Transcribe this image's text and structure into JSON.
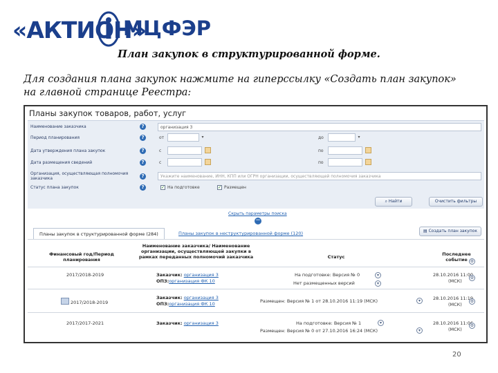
{
  "branding": {
    "aktion": "«АКТИОН»",
    "mcfer": "МЦФЭР",
    "seal_letter": "i"
  },
  "slide": {
    "title": "План закупок в структурированной форме.",
    "text": "Для создания плана закупок нажмите на гиперссылку «Создать план закупок» на главной странице Реестра:",
    "page_number": "20"
  },
  "panel": {
    "title": "Планы закупок товаров, работ, услуг",
    "filters": {
      "customer_label": "Наименование заказчика",
      "customer_value": "организация 3",
      "period_label": "Период планирования",
      "from": "от",
      "to": "до",
      "approval_label": "Дата утверждения плана закупок",
      "placement_label": "Дата размещения сведений",
      "c": "с",
      "po": "по",
      "org_label": "Организация, осуществляющая полномочия заказчика",
      "org_placeholder": "Укажите наименование, ИНН, КПП или ОГРН организации, осуществляющей полномочия заказчика",
      "status_label": "Статус плана закупок",
      "status_opt1": "На подготовке",
      "status_opt2": "Размещен",
      "find_button": "Найти",
      "clear_button": "Очистить фильтры",
      "collapse_link": "Скрыть параметры поиска"
    },
    "tabs": {
      "tab1": "Планы закупок в структурированной форме (284)",
      "tab2": "Планы закупок в неструктурированной форме (120)",
      "create_button": "Создать план закупок"
    },
    "table": {
      "headers": {
        "period": "Финансовый год/Период планирования",
        "customer": "Наименование заказчика/ Наименование организации, осуществляющей закупки в рамках переданных полномочий заказчика",
        "status": "Статус",
        "last_event": "Последнее событие"
      },
      "rows": [
        {
          "period": "2017/2018-2019",
          "customer_label": "Заказчик:",
          "customer_value": "организация 3",
          "ops_label": "ОПЗ:",
          "ops_value": "организация ФК 10",
          "status1": "На подготовке: Версия № 0",
          "status2": "Нет размещенных версий",
          "date": "28.10.2016 11:00",
          "tz": "(МСК)"
        },
        {
          "period": "2017/2018-2019",
          "customer_label": "Заказчик:",
          "customer_value": "организация 3",
          "ops_label": "ОПЗ:",
          "ops_value": "организация ФК 10",
          "status1": "Размещен: Версия № 1 от 28.10.2016 11:19 (МСК)",
          "date": "28.10.2016 11:19",
          "tz": "(МСК)"
        },
        {
          "period": "2017/2017-2021",
          "customer_label": "Заказчик:",
          "customer_value": "организация 3",
          "status1": "На подготовке: Версия № 1",
          "status2": "Размещен: Версия № 0 от 27.10.2016 16:24 (МСК)",
          "date": "28.10.2016 11:06",
          "tz": "(МСК)"
        }
      ]
    }
  },
  "colors": {
    "brand": "#1b3f8c",
    "link": "#1f5fb0",
    "panel_bg": "#e9eef5"
  }
}
